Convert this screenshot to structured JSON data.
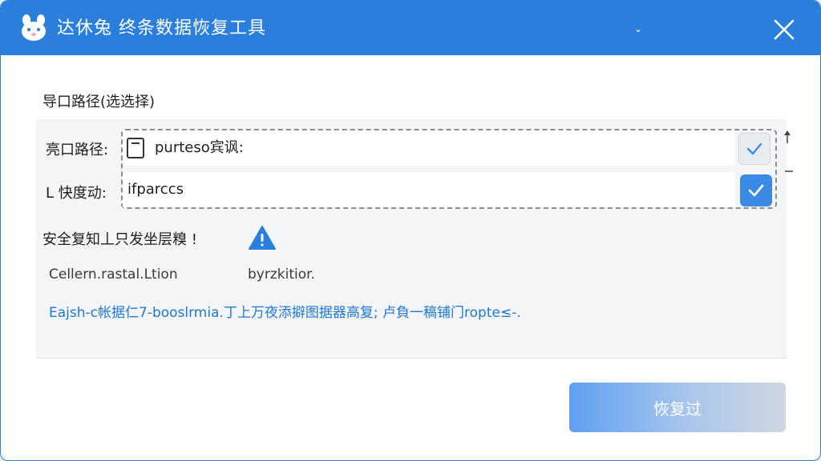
{
  "window": {
    "title": "达休兔 终条数据恢复工具",
    "menu_glyph": "⌄",
    "accent_color": "#2b7fdc"
  },
  "export_section": {
    "label": "导口路径(选选择)",
    "path_row": {
      "label": "亮口路径:",
      "value": "purteso宾讽:"
    },
    "driver_row": {
      "label": "L 快度动:",
      "value": "ifparccs"
    }
  },
  "warning": {
    "text": "安全复知丄只发坐层糗 !",
    "icon": "warning-triangle-icon"
  },
  "info": {
    "left": "Cellern.rastal.Ltion",
    "right": "byrzkitior."
  },
  "link": {
    "text": "Eajsh-c帐据仁7-booslrmia.丁上万夜添擗图据器高复; 卢負一稿铺门ropte≤-."
  },
  "actions": {
    "recover_label": "恢复过"
  },
  "icons": {
    "logo": "rabbit-logo-icon",
    "close": "close-icon",
    "file": "file-icon",
    "check": "check-icon"
  }
}
